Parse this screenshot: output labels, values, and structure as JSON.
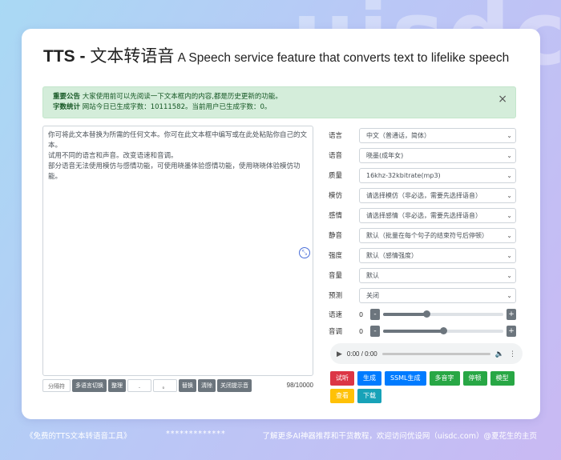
{
  "background_watermark": "uisdc",
  "header": {
    "title_main": "TTS - ",
    "title_cn": "文本转语音",
    "title_sub": " A Speech service feature that converts text to lifelike speech"
  },
  "alert": {
    "notice_label": "重要公告",
    "notice_text": " 大家使用前可以先阅读一下文本框内的内容,都是历史更新的功能。",
    "stats_label": "字数统计",
    "stats_text": " 网站今日已生成字数：10111582。当前用户已生成字数：0。",
    "close": "×"
  },
  "editor": {
    "text_lines": [
      "你可将此文本替换为所需的任何文本。你可在此文本框中编写或在此处粘贴你自己的文本。",
      "试用不同的语言和声音。改变语速和音调。",
      "部分语音无法使用模仿与感情功能，可使用晓墨体验感情功能，使用晓晓体验模仿功能。"
    ],
    "expand_icon": "⤡",
    "counter": "98/10000"
  },
  "toolbar": {
    "separator": "分隔符",
    "multi_lang": "多语言切换",
    "tidy": "整理",
    "input1": ".",
    "input2": "。",
    "replace": "替换",
    "clear": "清除",
    "close_hint": "关闭提示音"
  },
  "settings": [
    {
      "label": "语言",
      "value": "中文（普通话，简体）"
    },
    {
      "label": "语音",
      "value": "晓墨(成年女)"
    },
    {
      "label": "质量",
      "value": "16khz-32kbitrate(mp3)"
    },
    {
      "label": "模仿",
      "value": "请选择模仿（非必选，需要先选择语音）"
    },
    {
      "label": "感情",
      "value": "请选择感情（非必选，需要先选择语音）"
    },
    {
      "label": "静音",
      "value": "默认（批量在每个句子的结束符号后停顿）"
    },
    {
      "label": "强度",
      "value": "默认（感情强度）"
    },
    {
      "label": "音量",
      "value": "默认"
    },
    {
      "label": "预测",
      "value": "关闭"
    }
  ],
  "sliders": [
    {
      "label": "语速",
      "value": "0",
      "level": 0.36
    },
    {
      "label": "音调",
      "value": "0",
      "level": 0.5
    }
  ],
  "audio": {
    "time": "0:00 / 0:00"
  },
  "buttons": [
    {
      "label": "试听",
      "color": "#dc3545"
    },
    {
      "label": "生成",
      "color": "#007bff"
    },
    {
      "label": "SSML生成",
      "color": "#007bff"
    },
    {
      "label": "多音字",
      "color": "#28a745"
    },
    {
      "label": "停顿",
      "color": "#28a745"
    },
    {
      "label": "模型",
      "color": "#28a745"
    },
    {
      "label": "查看",
      "color": "#ffc107"
    },
    {
      "label": "下载",
      "color": "#17a2b8"
    }
  ],
  "footer": {
    "left": "《免费的TTS文本转语音工具》",
    "mid": "*************",
    "right": "了解更多AI神器推荐和干货教程，欢迎访问优设网（uisdc.com）@夏花生的主页"
  }
}
